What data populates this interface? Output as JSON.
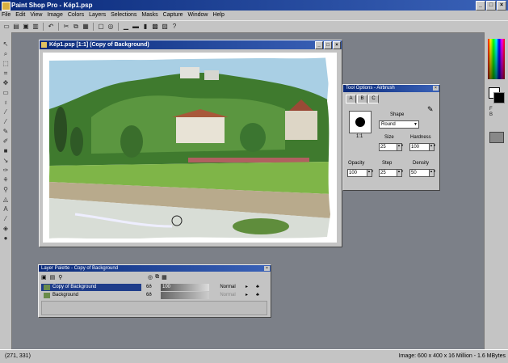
{
  "app": {
    "title": "Paint Shop Pro - Kép1.psp",
    "window_buttons": [
      "_",
      "□",
      "×"
    ]
  },
  "menu": [
    "File",
    "Edit",
    "View",
    "Image",
    "Colors",
    "Layers",
    "Selections",
    "Masks",
    "Capture",
    "Window",
    "Help"
  ],
  "toolbar_icons": [
    "new-icon",
    "open-icon",
    "save-icon",
    "print-icon",
    "undo-icon",
    "cut-icon",
    "copy-icon",
    "paste-icon",
    "screen-icon",
    "zoom-icon",
    "histogram-icon",
    "brush-toggle-icon",
    "layer-toggle-icon",
    "help-icon"
  ],
  "tools": [
    "arrow-icon",
    "zoom-icon",
    "deform-icon",
    "crop-icon",
    "mover-icon",
    "selection-icon",
    "lasso-icon",
    "wand-icon",
    "dropper-icon",
    "paintbrush-icon",
    "clone-icon",
    "replace-icon",
    "retouch-icon",
    "scratch-icon",
    "eraser-icon",
    "picture-tube-icon",
    "airbrush-icon",
    "flood-fill-icon",
    "text-icon",
    "draw-icon",
    "preset-shapes-icon"
  ],
  "image_window": {
    "title": "Kép1.psp [1:1] (Copy of Background)",
    "buttons": [
      "_",
      "□",
      "×"
    ]
  },
  "tool_options": {
    "title": "Tool Options - Airbrush",
    "tabs": [
      "A",
      "B",
      "C"
    ],
    "shape_label": "Shape",
    "shape_value": "Round",
    "scale": "1:1",
    "size_label": "Size",
    "size_value": "25",
    "hardness_label": "Hardness",
    "hardness_value": "100",
    "opacity_label": "Opacity",
    "opacity_value": "100",
    "step_label": "Step",
    "step_value": "25",
    "density_label": "Density",
    "density_value": "50"
  },
  "layer_palette": {
    "title": "Layer Palette - Copy of Background",
    "layers": [
      {
        "name": "Copy of Background",
        "opacity": "100",
        "blend": "Normal",
        "selected": true
      },
      {
        "name": "Background",
        "opacity": "",
        "blend": "Normal",
        "selected": false
      }
    ]
  },
  "status": {
    "coords": "(271, 331)",
    "image_info": "Image: 600 x 400 x 16 Million - 1.6 MBytes"
  },
  "swatch_labels": [
    "F",
    "B"
  ]
}
